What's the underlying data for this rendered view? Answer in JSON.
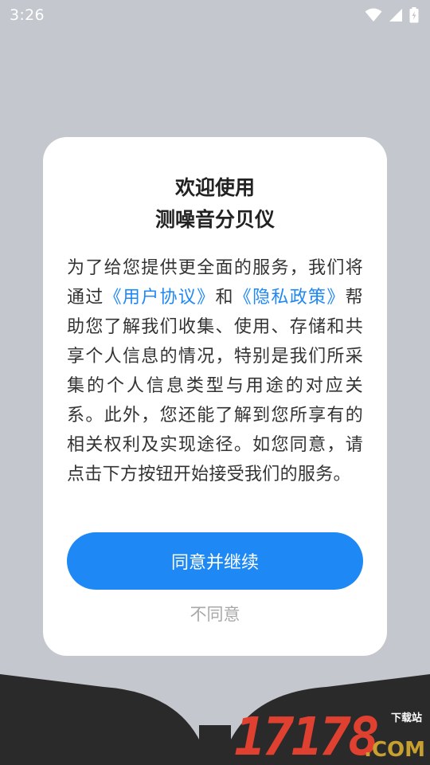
{
  "status_bar": {
    "time": "3:26",
    "icons": [
      "wifi-icon",
      "signal-icon",
      "battery-icon"
    ]
  },
  "dialog": {
    "title_line1": "欢迎使用",
    "title_line2": "测噪音分贝仪",
    "body": {
      "part1": "为了给您提供更全面的服务，我们将通过",
      "link_user_agreement": "《用户协议》",
      "part2": "和",
      "link_privacy_policy": "《隐私政策》",
      "part3": "帮助您了解我们收集、使用、存储和共享个人信息的情况，特别是我们所采集的个人信息类型与用途的对应关系。此外，您还能了解到您所享有的相关权利及实现途径。如您同意，请点击下方按钮开始接受我们的服务。"
    },
    "agree_label": "同意并继续",
    "disagree_label": "不同意"
  },
  "watermark": {
    "digits": "17178",
    "suffix": ".COM",
    "tag": "下载站"
  },
  "colors": {
    "accent": "#1e88f5",
    "backdrop": "#c4c7ce",
    "dialog_bg": "#ffffff",
    "bottom_band": "#2a2a2a"
  }
}
